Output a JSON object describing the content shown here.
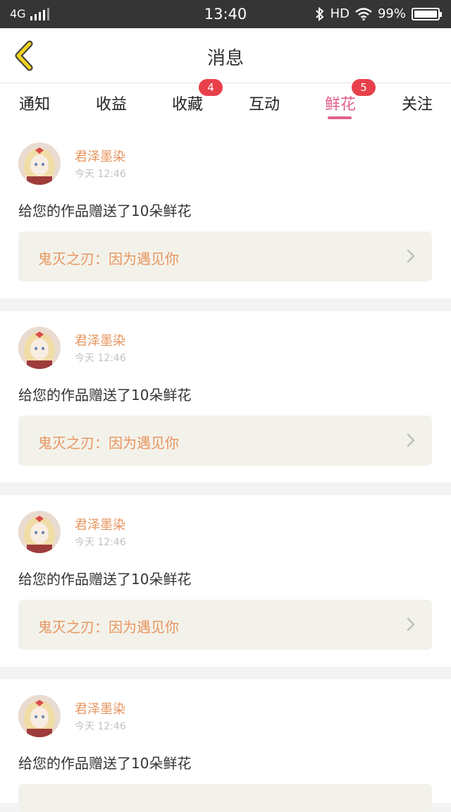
{
  "status_bar": {
    "network": "4G",
    "signal_bars": 4,
    "time": "13:40",
    "hd_label": "HD",
    "battery_text": "99%",
    "battery_level": 0.99
  },
  "header": {
    "title": "消息",
    "back_icon": "chevron-left-icon"
  },
  "tabs": [
    {
      "label": "通知"
    },
    {
      "label": "收益"
    },
    {
      "label": "收藏",
      "badge": "4"
    },
    {
      "label": "互动"
    },
    {
      "label": "鲜花",
      "badge": "5",
      "active": true
    },
    {
      "label": "关注"
    }
  ],
  "accent_color": "#e25f8f",
  "badge_color": "#e8404a",
  "messages": [
    {
      "user": "君泽墨染",
      "time": "今天 12:46",
      "text": "给您的作品赠送了10朵鲜花",
      "work": "鬼灭之刃：因为遇见你"
    },
    {
      "user": "君泽墨染",
      "time": "今天 12:46",
      "text": "给您的作品赠送了10朵鲜花",
      "work": "鬼灭之刃：因为遇见你"
    },
    {
      "user": "君泽墨染",
      "time": "今天 12:46",
      "text": "给您的作品赠送了10朵鲜花",
      "work": "鬼灭之刃：因为遇见你"
    },
    {
      "user": "君泽墨染",
      "time": "今天 12:46",
      "text": "给您的作品赠送了10朵鲜花",
      "work": ""
    }
  ]
}
